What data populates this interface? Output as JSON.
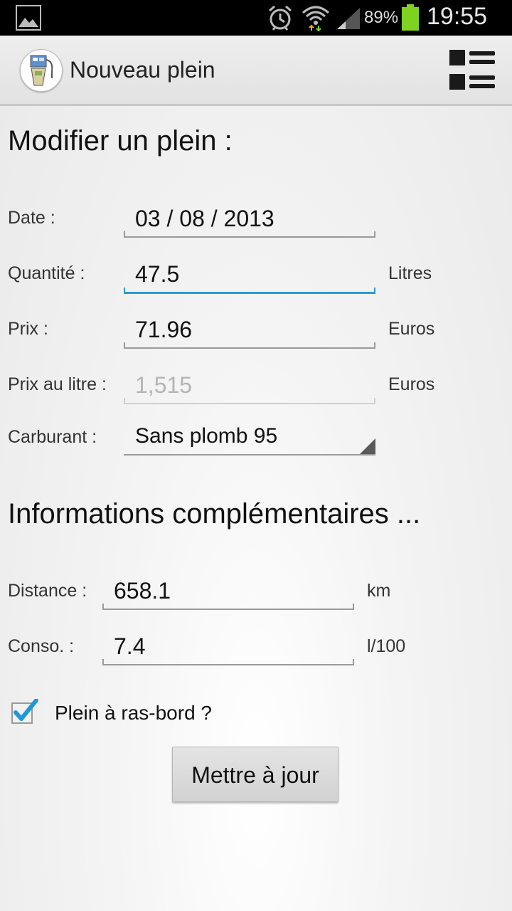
{
  "status_bar": {
    "battery_percent": "89%",
    "time": "19:55"
  },
  "action_bar": {
    "title": "Nouveau plein"
  },
  "form": {
    "heading": "Modifier un plein :",
    "date_label": "Date :",
    "date_value": "03 / 08 / 2013",
    "quantity_label": "Quantité :",
    "quantity_value": "47.5",
    "quantity_unit": "Litres",
    "price_label": "Prix :",
    "price_value": "71.96",
    "price_unit": "Euros",
    "unit_price_label": "Prix au litre :",
    "unit_price_value": "1,515",
    "unit_price_unit": "Euros",
    "fuel_label": "Carburant :",
    "fuel_value": "Sans plomb 95"
  },
  "extra": {
    "heading": "Informations complémentaires ...",
    "distance_label": "Distance :",
    "distance_value": "658.1",
    "distance_unit": "km",
    "consumption_label": "Conso. :",
    "consumption_value": "7.4",
    "consumption_unit": "l/100",
    "full_tank_label": "Plein à ras-bord ?",
    "full_tank_checked": true
  },
  "buttons": {
    "update_label": "Mettre à jour"
  },
  "colors": {
    "focus_accent": "#2a9bd1",
    "checkbox_check": "#1e98d8",
    "battery": "#7ed321"
  },
  "icons": [
    "gallery-icon",
    "alarm-icon",
    "wifi-icon",
    "signal-icon",
    "battery-icon",
    "fuel-pump-icon",
    "list-menu-icon",
    "checkmark-icon",
    "dropdown-arrow-icon"
  ]
}
